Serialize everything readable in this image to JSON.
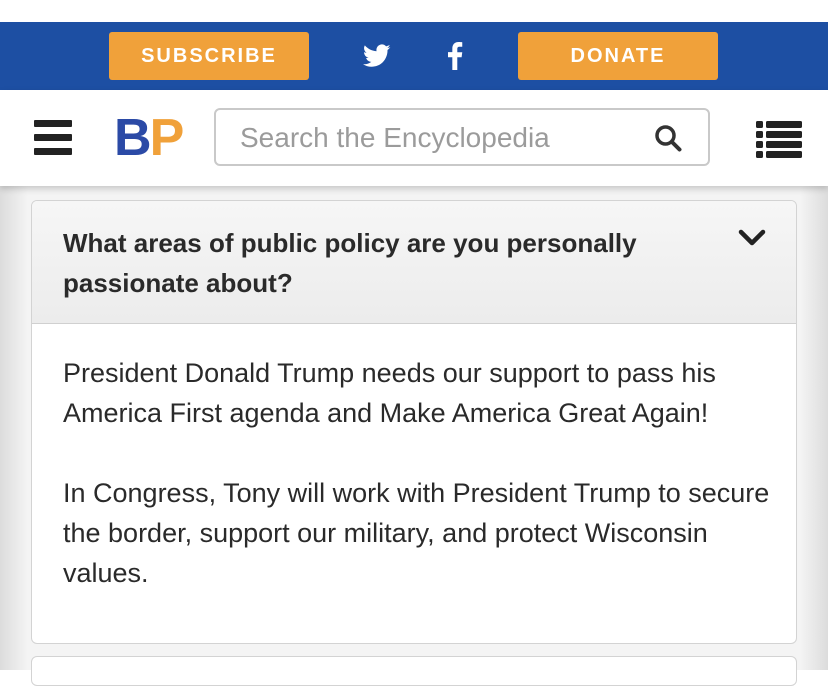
{
  "top_bar": {
    "subscribe_label": "SUBSCRIBE",
    "donate_label": "DONATE",
    "social_icons": [
      "twitter-icon",
      "facebook-icon"
    ],
    "background_color": "#1d4fa3",
    "button_color": "#f0a13a"
  },
  "header": {
    "logo": {
      "b": "B",
      "p": "P"
    },
    "search_placeholder": "Search the Encyclopedia",
    "search_value": "",
    "menu_icon": "hamburger-menu-icon",
    "list_icon": "list-icon"
  },
  "accordion": {
    "question": "What areas of public policy are you personally passionate about?",
    "answer_paragraphs": [
      "President Donald Trump needs our support to pass his America First agenda and Make America Great Again!",
      "In Congress, Tony will work with President Trump to secure the border, support our military, and protect Wisconsin values."
    ],
    "expanded": true
  }
}
